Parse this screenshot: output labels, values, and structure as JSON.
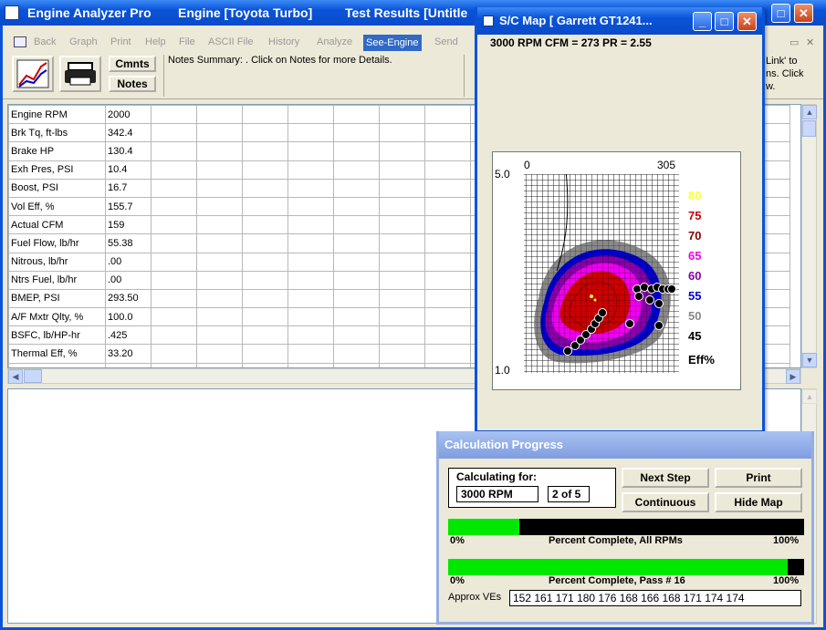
{
  "main_window": {
    "app_title": "Engine Analyzer Pro",
    "engine_title": "Engine [Toyota Turbo]",
    "results_title": "Test Results [Untitle",
    "right_fragment_1": "Link' to",
    "right_fragment_2": "ns. Click",
    "right_fragment_3": "w."
  },
  "menu": [
    "Back",
    "Graph",
    "Print",
    "Help",
    "File",
    "ASCII File",
    "History",
    "Analyze",
    "See-Engine",
    "Send"
  ],
  "menu_active": "See-Engine",
  "toolbar": {
    "comments_label": "Cmnts",
    "notes_label": "Notes",
    "notes_summary": "Notes Summary:  .  Click on Notes for more Details."
  },
  "grid": {
    "rows": [
      {
        "label": "Engine RPM",
        "value": "2000"
      },
      {
        "label": "Brk Tq, ft-lbs",
        "value": "342.4"
      },
      {
        "label": "Brake HP",
        "value": "130.4"
      },
      {
        "label": "Exh Pres, PSI",
        "value": "10.4"
      },
      {
        "label": "Boost, PSI",
        "value": "16.7"
      },
      {
        "label": "Vol Eff, %",
        "value": "155.7"
      },
      {
        "label": "Actual CFM",
        "value": "159"
      },
      {
        "label": "Fuel Flow, lb/hr",
        "value": "55.38"
      },
      {
        "label": "Nitrous, lb/hr",
        "value": ".00"
      },
      {
        "label": "Ntrs Fuel, lb/hr",
        "value": ".00"
      },
      {
        "label": "BMEP, PSI",
        "value": "293.50"
      },
      {
        "label": "A/F Mxtr Qlty, %",
        "value": "100.0"
      },
      {
        "label": "BSFC, lb/HP-hr",
        "value": ".425"
      },
      {
        "label": "Thermal Eff, %",
        "value": "33.20"
      }
    ]
  },
  "sc_map": {
    "title": "S/C Map  [ Garrett GT1241...",
    "info": "3000 RPM    CFM = 273    PR = 2.55",
    "y_max": "5.0",
    "y_min": "1.0",
    "x_min": "0",
    "x_max": "305",
    "legend": [
      {
        "label": "80",
        "color": "#ffff33"
      },
      {
        "label": "75",
        "color": "#cc0000"
      },
      {
        "label": "70",
        "color": "#880000"
      },
      {
        "label": "65",
        "color": "#ee00ee"
      },
      {
        "label": "60",
        "color": "#8800aa"
      },
      {
        "label": "55",
        "color": "#0000cc"
      },
      {
        "label": "50",
        "color": "#888888"
      },
      {
        "label": "45",
        "color": "#000000"
      }
    ],
    "eff_label": "Eff%"
  },
  "calc": {
    "title": "Calculation Progress",
    "calculating_for": "Calculating for:",
    "rpm": "3000 RPM",
    "step": "2 of 5",
    "next_step": "Next Step",
    "print": "Print",
    "continuous": "Continuous",
    "hide_map": "Hide Map",
    "all_rpms_fraction": 0.2,
    "pass_fraction": 0.955,
    "zero_label": "0%",
    "hundred_label": "100%",
    "all_rpms_label": "Percent Complete, All RPMs",
    "pass_label": "Percent Complete, Pass #  16",
    "ves_label": "Approx VEs",
    "ves": "152  161  171  180  176  168  166  168  171  174  174"
  }
}
